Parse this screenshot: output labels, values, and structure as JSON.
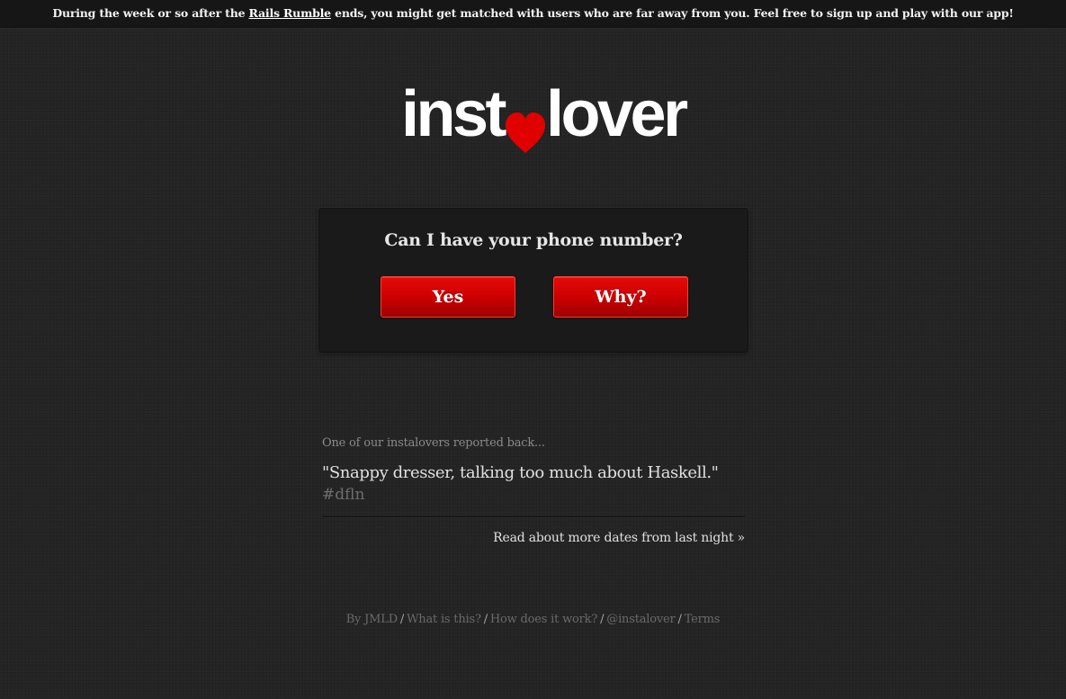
{
  "notice": {
    "prefix": "During the week or so after the ",
    "link": "Rails Rumble",
    "suffix": " ends, you might get matched with users who are far away from you. Feel free to sign up and play with our app!"
  },
  "logo": {
    "left": "inst",
    "right": "lover",
    "heart_icon": "heart-icon",
    "heart_color": "#e00000"
  },
  "prompt": {
    "question": "Can I have your phone number?",
    "yes_label": "Yes",
    "why_label": "Why?"
  },
  "report": {
    "intro": "One of our instalovers reported back...",
    "quote": "\"Snappy dresser, talking too much about Haskell.\"",
    "tag": "#dfln",
    "more_link": "Read about more dates from last night »"
  },
  "footer": {
    "links": [
      "By JMLD",
      "What is this?",
      "How does it work?",
      "@instalover",
      "Terms"
    ],
    "separator": "/"
  },
  "colors": {
    "background": "#252525",
    "accent": "#cc0000",
    "topbar": "#161616"
  }
}
